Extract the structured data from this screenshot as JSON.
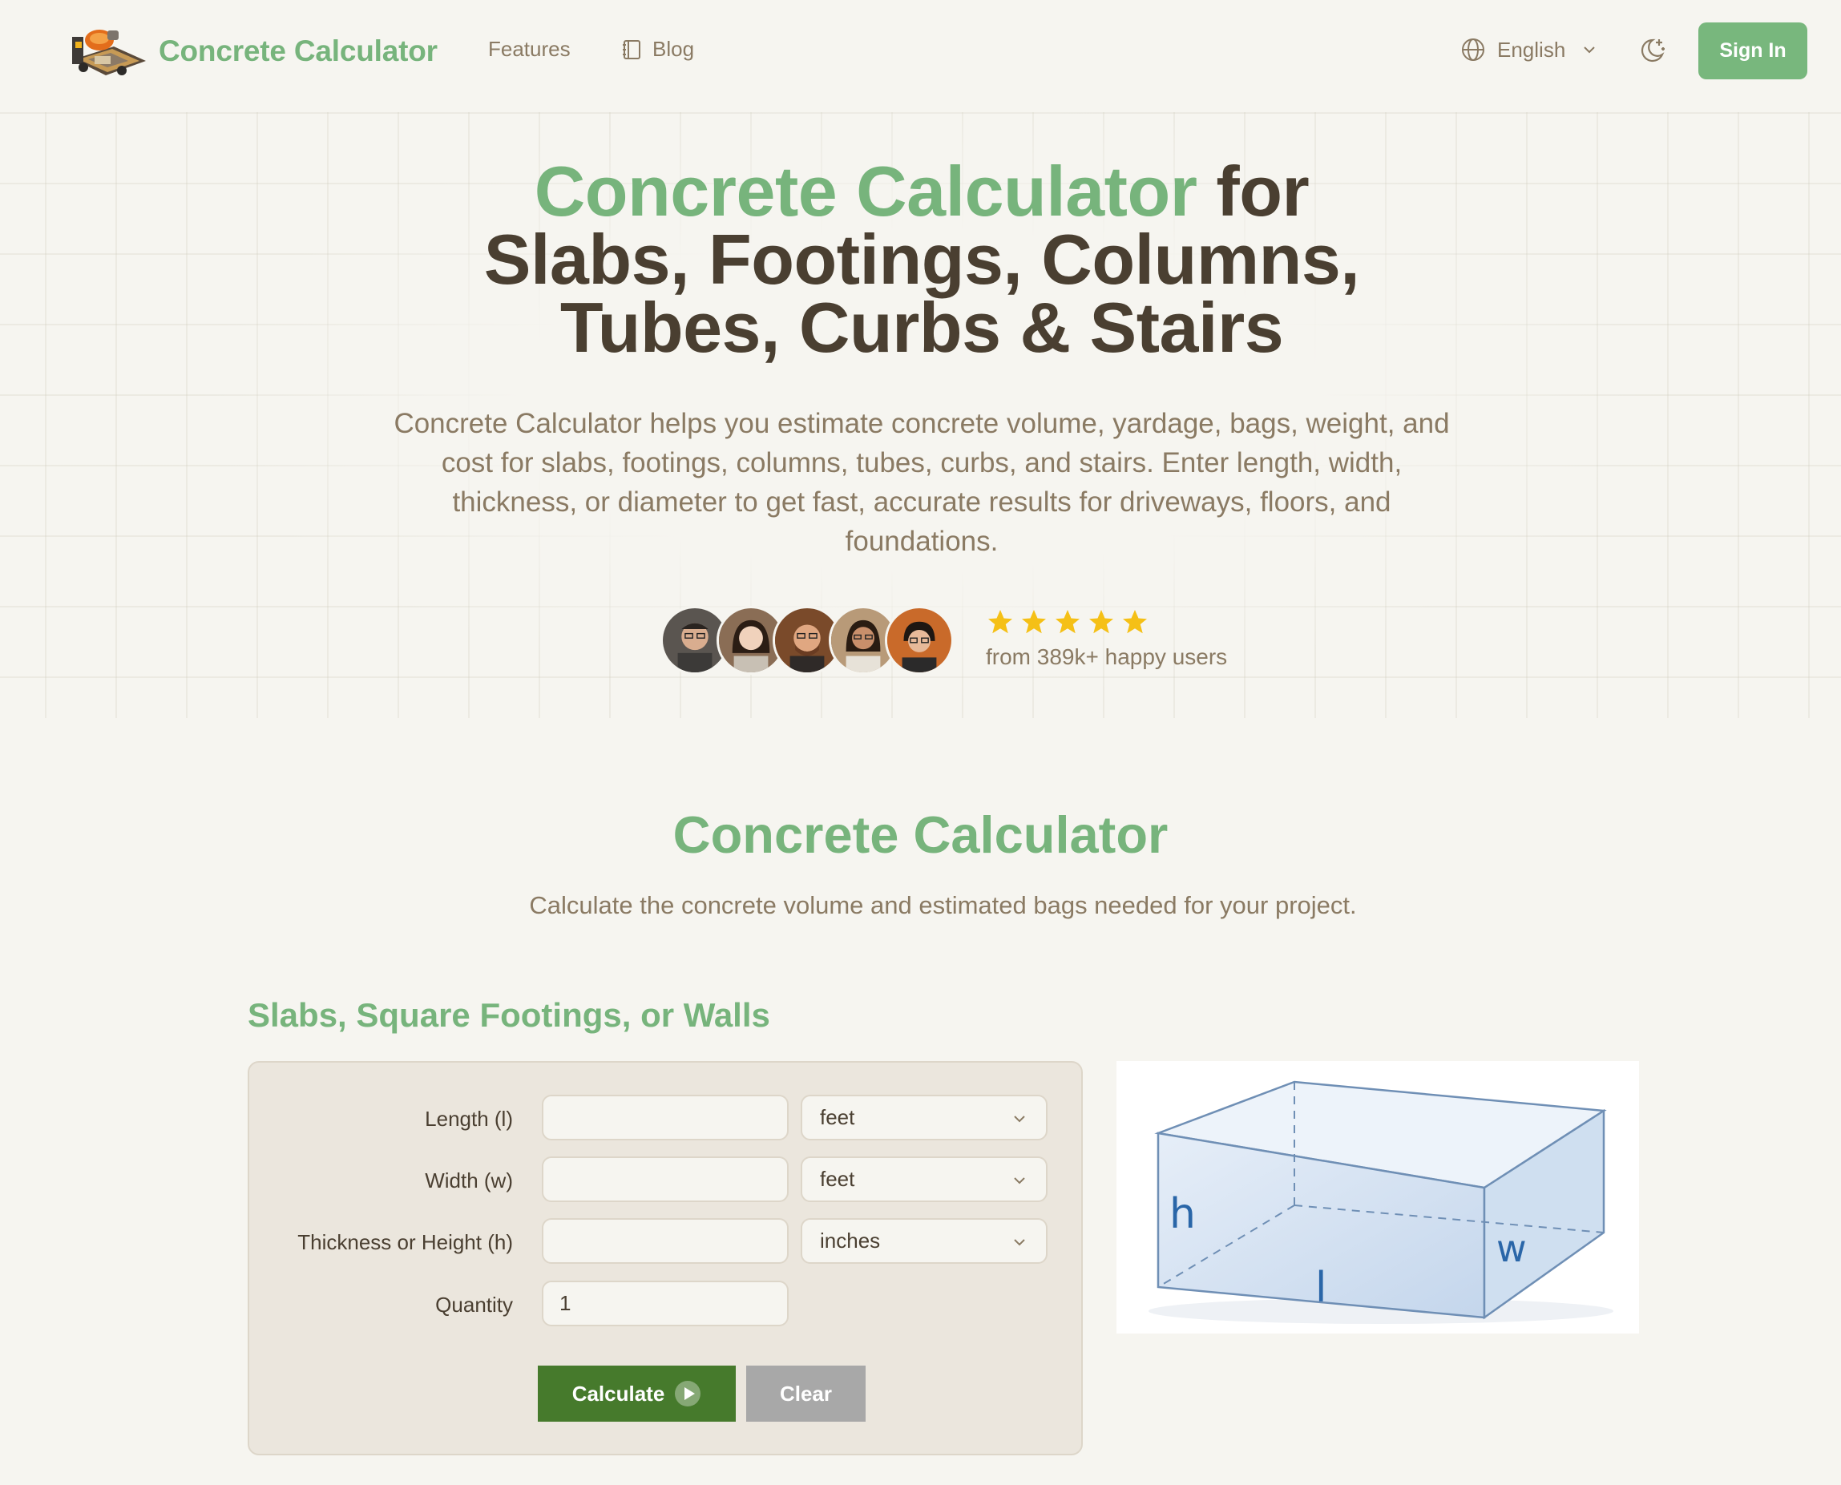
{
  "header": {
    "brand": "Concrete Calculator",
    "nav": {
      "features": "Features",
      "blog": "Blog"
    },
    "language": "English",
    "sign_in": "Sign In"
  },
  "hero": {
    "title_accent": "Concrete Calculator",
    "title_rest_1": " for",
    "title_line_2": "Slabs, Footings, Columns,",
    "title_line_3": "Tubes, Curbs & Stairs",
    "description": "Concrete Calculator helps you estimate concrete volume, yardage, bags, weight, and cost for slabs, footings, columns, tubes, curbs, and stairs. Enter length, width, thickness, or diameter to get fast, accurate results for driveways, floors, and foundations.",
    "rating_stars": 5,
    "social_proof": "from 389k+ happy users"
  },
  "calculator": {
    "title": "Concrete Calculator",
    "subtitle": "Calculate the concrete volume and estimated bags needed for your project.",
    "section_title": "Slabs, Square Footings, or Walls",
    "rows": [
      {
        "label": "Length (l)",
        "value": "",
        "unit": "feet"
      },
      {
        "label": "Width (w)",
        "value": "",
        "unit": "feet"
      },
      {
        "label": "Thickness or Height (h)",
        "value": "",
        "unit": "inches"
      },
      {
        "label": "Quantity",
        "value": "1"
      }
    ],
    "calculate_label": "Calculate",
    "clear_label": "Clear",
    "diagram_labels": {
      "h": "h",
      "l": "l",
      "w": "w"
    }
  },
  "colors": {
    "accent": "#77b47c",
    "text_dark": "#4a3f31",
    "text_muted": "#8a7a63",
    "calculate_button": "#467a2c",
    "clear_button": "#a8a8a8",
    "star": "#f5c016"
  }
}
